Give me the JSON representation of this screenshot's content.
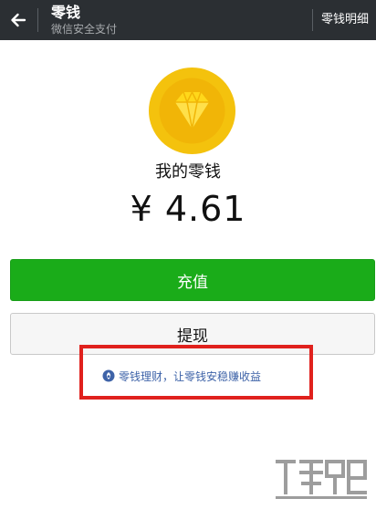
{
  "header": {
    "title": "零钱",
    "subtitle": "微信安全支付",
    "details_label": "零钱明细"
  },
  "balance": {
    "label": "我的零钱",
    "amount": "¥ 4.61"
  },
  "actions": {
    "recharge_label": "充值",
    "withdraw_label": "提现"
  },
  "promo": {
    "text": "零钱理财，让零钱安稳赚收益"
  },
  "icons": {
    "back": "arrow-left-icon",
    "coin": "diamond-coin-icon",
    "promo": "fund-icon"
  },
  "colors": {
    "topbar": "#2b2f33",
    "primary_green": "#1aac19",
    "coin_gold": "#f4c20d",
    "link_blue": "#3e63a8",
    "highlight_red": "#e0211d"
  }
}
